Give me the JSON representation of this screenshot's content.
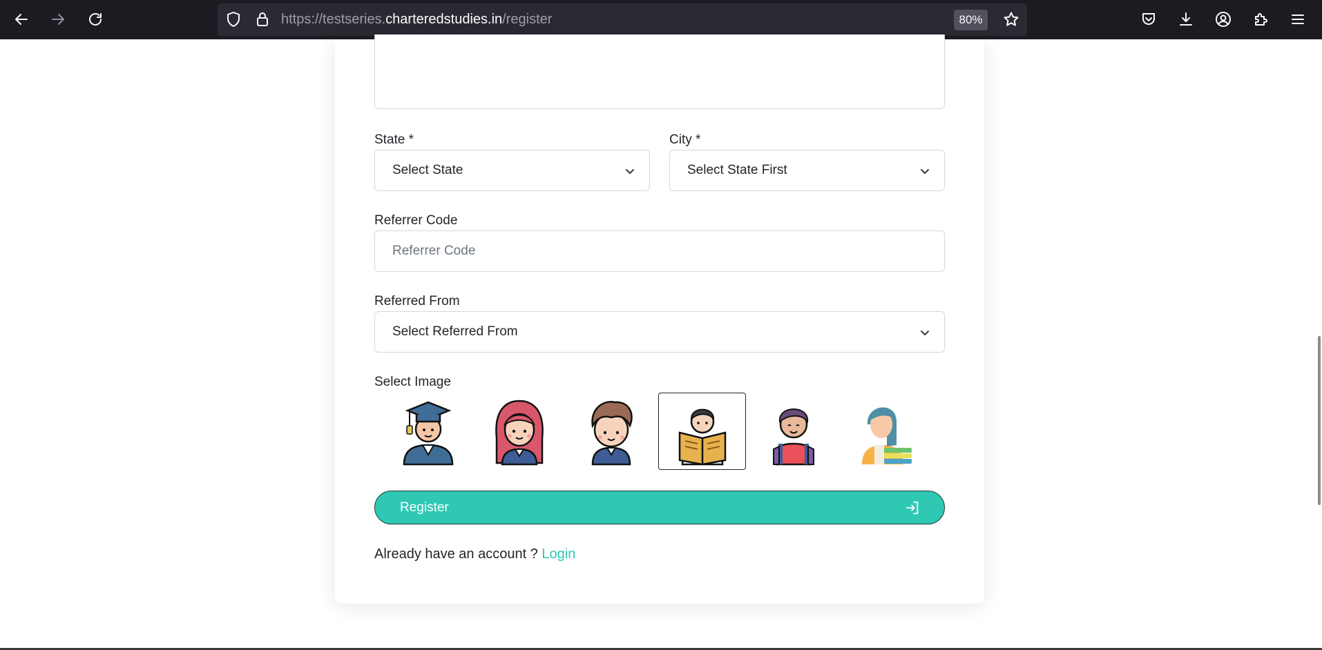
{
  "browser": {
    "url_host_prefix": "https://testseries.",
    "url_host_domain": "charteredstudies.in",
    "url_path": "/register",
    "zoom": "80%",
    "icons": {
      "back": "arrow-left-icon",
      "forward": "arrow-right-icon",
      "reload": "reload-icon",
      "tracking": "shield-icon",
      "lock": "lock-icon",
      "bookmark": "star-icon",
      "pocket": "pocket-icon",
      "downloads": "download-icon",
      "account": "account-icon",
      "extensions": "puzzle-icon",
      "menu": "hamburger-menu-icon"
    }
  },
  "form": {
    "state": {
      "label": "State *",
      "selected": "Select State"
    },
    "city": {
      "label": "City *",
      "selected": "Select State First"
    },
    "referrer_code": {
      "label": "Referrer Code",
      "placeholder": "Referrer Code"
    },
    "referred_from": {
      "label": "Referred From",
      "selected": "Select Referred From"
    },
    "select_image": {
      "label": "Select Image",
      "options": [
        "graduate-avatar-icon",
        "girl-student-avatar-icon",
        "boy-student-avatar-icon",
        "reading-student-avatar-icon",
        "schoolboy-backpack-avatar-icon",
        "girl-books-avatar-icon"
      ],
      "selected_index": 3
    },
    "register_button": {
      "label": "Register",
      "icon": "login-arrow-icon"
    },
    "login_prompt": {
      "text": "Already have an account ?",
      "link": "Login"
    }
  },
  "colors": {
    "accent": "#2ec8b3",
    "toolbar": "#1c1b22",
    "urlbar": "#2b2a33"
  }
}
